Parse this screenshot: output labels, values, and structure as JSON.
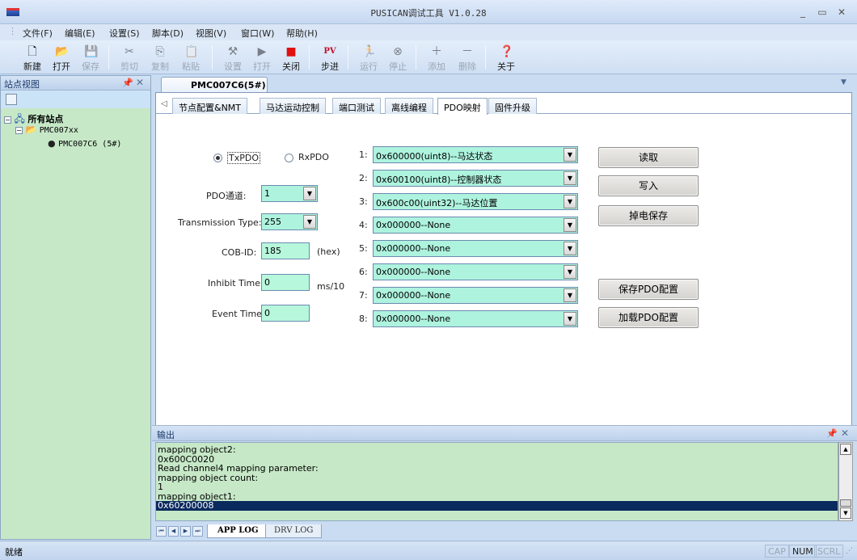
{
  "window": {
    "title": "PUSICAN调试工具 V1.0.28"
  },
  "menu": [
    "文件(F)",
    "编辑(E)",
    "设置(S)",
    "脚本(D)",
    "视图(V)",
    "窗口(W)",
    "帮助(H)"
  ],
  "toolbar": {
    "new": "新建",
    "open": "打开",
    "save": "保存",
    "cut": "剪切",
    "copy": "复制",
    "paste": "粘贴",
    "settings": "设置",
    "open2": "打开",
    "close": "关闭",
    "step": "步进",
    "run": "运行",
    "stop": "停止",
    "add": "添加",
    "delete": "删除",
    "about": "关于",
    "pv_icon_text": "PV"
  },
  "site_view": {
    "title": "站点视图",
    "tree": {
      "root": "所有站点",
      "group": "PMC007xx",
      "node": "PMC007C6 (5#)"
    }
  },
  "doc_tab": "PMC007C6(5#)",
  "subtabs": [
    "节点配置&NMT",
    "马达运动控制",
    "端口测试",
    "离线编程",
    "PDO映射",
    "固件升级"
  ],
  "pdo": {
    "radio_tx": "TxPDO",
    "radio_rx": "RxPDO",
    "selected_radio": "TxPDO",
    "channel_label": "PDO通道:",
    "channel_value": "1",
    "trans_label": "Transmission Type:",
    "trans_value": "255",
    "cobid_label": "COB-ID:",
    "cobid_value": "185",
    "cobid_unit": "(hex)",
    "inhibit_label": "Inhibit Time:",
    "inhibit_value": "0",
    "inhibit_unit": "ms/10",
    "event_label": "Event Time:",
    "event_value": "0",
    "mappings": [
      {
        "n": "1:",
        "v": "0x600000(uint8)--马达状态"
      },
      {
        "n": "2:",
        "v": "0x600100(uint8)--控制器状态"
      },
      {
        "n": "3:",
        "v": "0x600c00(uint32)--马达位置"
      },
      {
        "n": "4:",
        "v": "0x000000--None"
      },
      {
        "n": "5:",
        "v": "0x000000--None"
      },
      {
        "n": "6:",
        "v": "0x000000--None"
      },
      {
        "n": "7:",
        "v": "0x000000--None"
      },
      {
        "n": "8:",
        "v": "0x000000--None"
      }
    ],
    "buttons": {
      "read": "读取",
      "write": "写入",
      "persist": "掉电保存",
      "save_cfg": "保存PDO配置",
      "load_cfg": "加载PDO配置"
    }
  },
  "output": {
    "title": "输出",
    "lines": [
      "mapping object2:",
      "0x600C0020",
      "Read channel4 mapping parameter:",
      "mapping object count:",
      "1",
      "mapping object1:",
      "0x60200008"
    ],
    "selected_line": 6,
    "tabs": [
      "APP LOG",
      "DRV LOG"
    ]
  },
  "status": {
    "text": "就绪",
    "cap": "CAP",
    "num": "NUM",
    "scrl": "SCRL"
  },
  "colors": {
    "field_green": "#aef3de",
    "panel_green": "#c6e8c7",
    "chrome_blue": "#c9dcf2",
    "selection": "#0a2a5e"
  }
}
